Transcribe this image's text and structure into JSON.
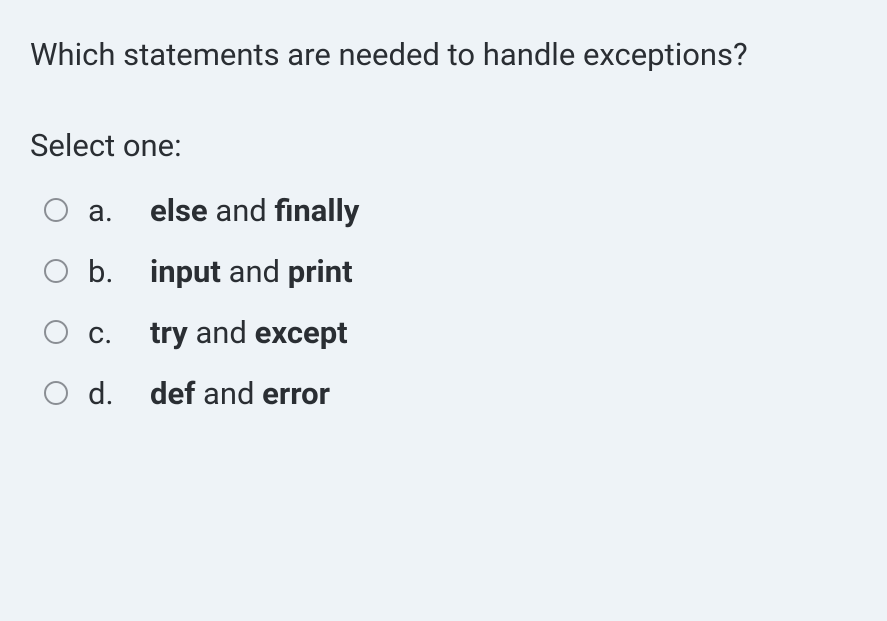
{
  "question": "Which statements are needed to handle exceptions?",
  "prompt": "Select one:",
  "options": [
    {
      "letter": "a.",
      "word1": "else",
      "connector": "and",
      "word2": "finally"
    },
    {
      "letter": "b.",
      "word1": "input",
      "connector": "and",
      "word2": "print"
    },
    {
      "letter": "c.",
      "word1": "try",
      "connector": "and",
      "word2": "except"
    },
    {
      "letter": "d.",
      "word1": "def",
      "connector": "and",
      "word2": "error"
    }
  ]
}
